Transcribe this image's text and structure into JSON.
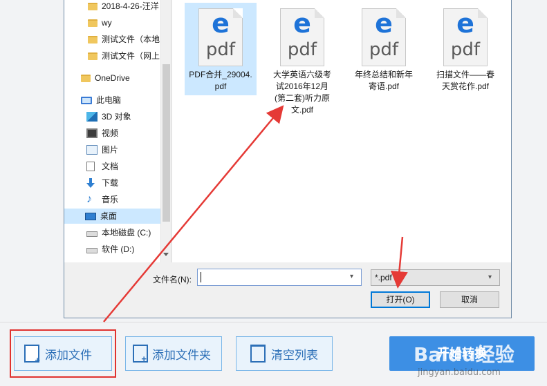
{
  "nav": {
    "items": [
      {
        "label": "2018-4-26-汪洋",
        "icon": "folder-icon"
      },
      {
        "label": "wy",
        "icon": "folder-icon"
      },
      {
        "label": "测试文件（本地",
        "icon": "folder-icon"
      },
      {
        "label": "测试文件（网上",
        "icon": "folder-icon"
      },
      {
        "label": "OneDrive",
        "icon": "folder-icon"
      },
      {
        "label": "此电脑",
        "icon": "computer-icon"
      },
      {
        "label": "3D 对象",
        "icon": "3d-objects-icon"
      },
      {
        "label": "视频",
        "icon": "video-icon"
      },
      {
        "label": "图片",
        "icon": "pictures-icon"
      },
      {
        "label": "文档",
        "icon": "documents-icon"
      },
      {
        "label": "下载",
        "icon": "download-icon"
      },
      {
        "label": "音乐",
        "icon": "music-icon"
      },
      {
        "label": "桌面",
        "icon": "desktop-icon"
      },
      {
        "label": "本地磁盘 (C:)",
        "icon": "drive-icon"
      },
      {
        "label": "软件 (D:)",
        "icon": "drive-icon"
      }
    ]
  },
  "files": [
    {
      "name": "PDF合并_29004.pdf",
      "icon_text": "pdf",
      "selected": true
    },
    {
      "name": "大学英语六级考试2016年12月(第二套)听力原文.pdf",
      "icon_text": "pdf",
      "selected": false
    },
    {
      "name": "年终总结和新年寄语.pdf",
      "icon_text": "pdf",
      "selected": false
    },
    {
      "name": "扫描文件——春天赏花作.pdf",
      "icon_text": "pdf",
      "selected": false
    }
  ],
  "filename": {
    "label": "文件名(N):",
    "value": ""
  },
  "filetype": {
    "value": "*.pdf"
  },
  "dialog_buttons": {
    "open": "打开(O)",
    "cancel": "取消"
  },
  "toolbar": {
    "add_file": "添加文件",
    "add_folder": "添加文件夹",
    "clear_list": "清空列表",
    "start": "开始转换"
  },
  "watermark": {
    "logo": "Baidu经验",
    "sub": "jingyan.baidu.com"
  },
  "colors": {
    "accent": "#3d8fe4",
    "annotation": "#e0322f",
    "selection": "#cce8ff"
  }
}
